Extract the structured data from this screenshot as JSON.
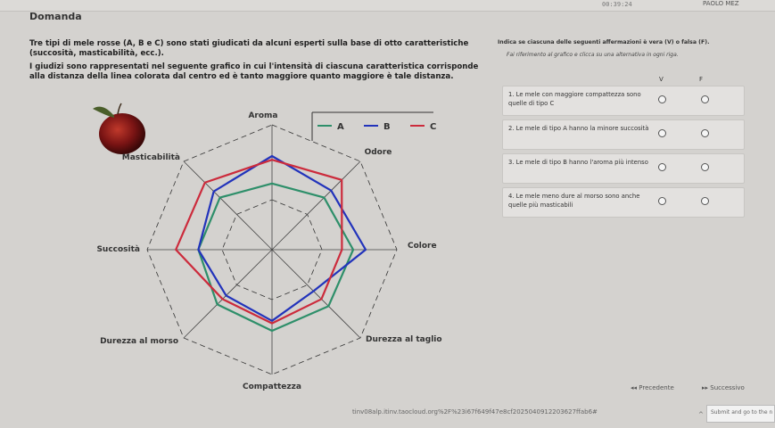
{
  "header": {
    "timer": "00:39:24",
    "user": "PAOLO MEZ"
  },
  "page_title": "Domanda",
  "intro": {
    "line1": "Tre tipi di mele rosse (A, B e C) sono stati giudicati da alcuni esperti sulla base di otto caratteristiche (succosità, masticabilità, ecc.).",
    "line2": "I giudizi sono rappresentati nel seguente grafico in cui l'intensità di ciascuna caratteristica corrisponde alla distanza della linea colorata dal centro ed è tanto maggiore quanto maggiore è tale distanza."
  },
  "instructions": {
    "main": "Indica se ciascuna delle seguenti affermazioni è vera (V) o falsa (F).",
    "sub": "Fai riferimento al grafico e clicca su una alternativa in ogni riga."
  },
  "table": {
    "col_v": "V",
    "col_f": "F",
    "statements": [
      {
        "text": "1. Le mele con maggiore compattezza sono quelle di tipo C"
      },
      {
        "text": "2. Le mele di tipo A hanno la minore succosità"
      },
      {
        "text": "3. Le mele di tipo B hanno l'aroma più intenso"
      },
      {
        "text": "4. Le mele meno dure al morso sono anche quelle più masticabili"
      }
    ]
  },
  "chart_data": {
    "type": "radar",
    "axes": [
      "Aroma",
      "Odore",
      "Colore",
      "Durezza al taglio",
      "Compattezza",
      "Durezza al morso",
      "Succosità",
      "Masticabilità"
    ],
    "rmax": 10,
    "series": [
      {
        "name": "A",
        "color": "#2e8f6a",
        "values": [
          5.3,
          5.9,
          6.5,
          6.4,
          6.5,
          6.2,
          5.9,
          5.9
        ]
      },
      {
        "name": "B",
        "color": "#2233bb",
        "values": [
          7.5,
          6.7,
          7.5,
          4.7,
          5.7,
          5.2,
          5.9,
          6.6
        ]
      },
      {
        "name": "C",
        "color": "#cc2b3c",
        "values": [
          7.2,
          7.9,
          5.6,
          5.6,
          5.9,
          5.6,
          7.7,
          7.6
        ]
      }
    ]
  },
  "nav": {
    "prev": "Precedente",
    "next": "Successivo",
    "submit": "Submit and go to the n",
    "url": "tinv08alp.itinv.taocloud.org%2F%23i67f649f47e8cf2025040912203627ffab6#"
  }
}
